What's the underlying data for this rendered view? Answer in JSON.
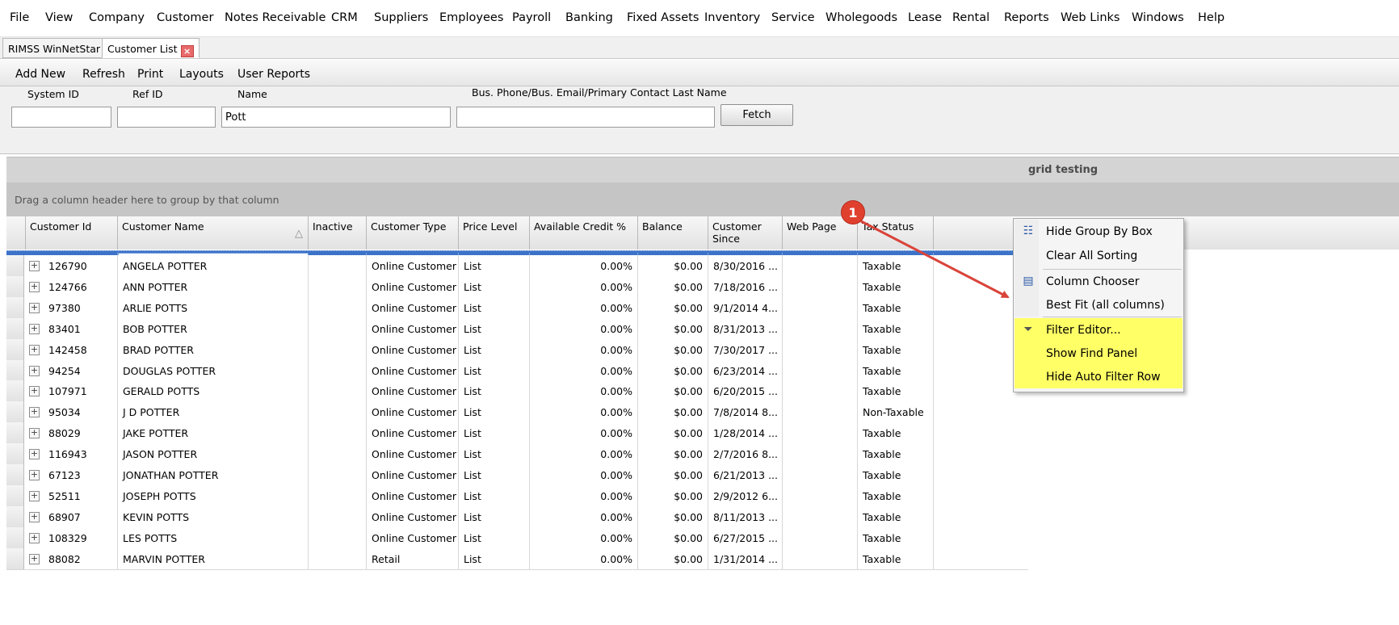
{
  "menu": [
    "File",
    "View",
    "Company",
    "Customer",
    "Notes Receivable",
    "CRM",
    "Suppliers",
    "Employees",
    "Payroll",
    "Banking",
    "Fixed Assets",
    "Inventory",
    "Service",
    "Wholegoods",
    "Lease",
    "Rental",
    "Reports",
    "Web Links",
    "Windows",
    "Help"
  ],
  "tabs": [
    {
      "label": "RIMSS WinNetStar"
    },
    {
      "label": "Customer List"
    }
  ],
  "toolbar": [
    "Add New",
    "Refresh",
    "Print",
    "Layouts",
    "User Reports"
  ],
  "filters": {
    "system_id_label": "System ID",
    "system_id_value": "",
    "ref_id_label": "Ref ID",
    "ref_id_value": "",
    "name_label": "Name",
    "name_value": "Pott",
    "contact_label": "Bus. Phone/Bus. Email/Primary Contact Last Name",
    "contact_value": "",
    "fetch_label": "Fetch"
  },
  "grid": {
    "caption": "grid testing",
    "group_prompt": "Drag a column header here to group by that column",
    "columns": [
      "Customer Id",
      "Customer Name",
      "Inactive",
      "Customer Type",
      "Price Level",
      "Available Credit %",
      "Balance",
      "Customer Since",
      "Web Page",
      "Tax Status"
    ],
    "rows": [
      [
        "126790",
        "ANGELA POTTER",
        "",
        "Online Customer",
        "List",
        "0.00%",
        "$0.00",
        "8/30/2016 ...",
        "",
        "Taxable"
      ],
      [
        "124766",
        "ANN POTTER",
        "",
        "Online Customer",
        "List",
        "0.00%",
        "$0.00",
        "7/18/2016 ...",
        "",
        "Taxable"
      ],
      [
        "97380",
        "ARLIE POTTS",
        "",
        "Online Customer",
        "List",
        "0.00%",
        "$0.00",
        "9/1/2014 4...",
        "",
        "Taxable"
      ],
      [
        "83401",
        "BOB POTTER",
        "",
        "Online Customer",
        "List",
        "0.00%",
        "$0.00",
        "8/31/2013 ...",
        "",
        "Taxable"
      ],
      [
        "142458",
        "BRAD POTTER",
        "",
        "Online Customer",
        "List",
        "0.00%",
        "$0.00",
        "7/30/2017 ...",
        "",
        "Taxable"
      ],
      [
        "94254",
        "DOUGLAS POTTER",
        "",
        "Online Customer",
        "List",
        "0.00%",
        "$0.00",
        "6/23/2014 ...",
        "",
        "Taxable"
      ],
      [
        "107971",
        "GERALD POTTS",
        "",
        "Online Customer",
        "List",
        "0.00%",
        "$0.00",
        "6/20/2015 ...",
        "",
        "Taxable"
      ],
      [
        "95034",
        "J D POTTER",
        "",
        "Online Customer",
        "List",
        "0.00%",
        "$0.00",
        "7/8/2014 8...",
        "",
        "Non-Taxable"
      ],
      [
        "88029",
        "JAKE POTTER",
        "",
        "Online Customer",
        "List",
        "0.00%",
        "$0.00",
        "1/28/2014 ...",
        "",
        "Taxable"
      ],
      [
        "116943",
        "JASON POTTER",
        "",
        "Online Customer",
        "List",
        "0.00%",
        "$0.00",
        "2/7/2016 8...",
        "",
        "Taxable"
      ],
      [
        "67123",
        "JONATHAN POTTER",
        "",
        "Online Customer",
        "List",
        "0.00%",
        "$0.00",
        "6/21/2013 ...",
        "",
        "Taxable"
      ],
      [
        "52511",
        "JOSEPH POTTS",
        "",
        "Online Customer",
        "List",
        "0.00%",
        "$0.00",
        "2/9/2012 6...",
        "",
        "Taxable"
      ],
      [
        "68907",
        "KEVIN POTTS",
        "",
        "Online Customer",
        "List",
        "0.00%",
        "$0.00",
        "8/11/2013 ...",
        "",
        "Taxable"
      ],
      [
        "108329",
        "LES POTTS",
        "",
        "Online Customer",
        "List",
        "0.00%",
        "$0.00",
        "6/27/2015 ...",
        "",
        "Taxable"
      ],
      [
        "88082",
        "MARVIN POTTER",
        "",
        "Retail",
        "List",
        "0.00%",
        "$0.00",
        "1/31/2014 ...",
        "",
        "Taxable"
      ]
    ]
  },
  "context_menu": {
    "items": [
      {
        "label": "Hide Group By Box",
        "icon": "group-box-icon",
        "highlight": false
      },
      {
        "label": "Clear All Sorting",
        "icon": "",
        "highlight": false
      },
      {
        "label": "Column Chooser",
        "icon": "column-chooser-icon",
        "highlight": false
      },
      {
        "label": "Best Fit (all columns)",
        "icon": "",
        "highlight": false
      },
      {
        "label": "Filter Editor...",
        "icon": "funnel-icon",
        "highlight": true
      },
      {
        "label": "Show Find Panel",
        "icon": "",
        "highlight": true
      },
      {
        "label": "Hide Auto Filter Row",
        "icon": "",
        "highlight": true
      }
    ]
  },
  "annotation": {
    "number": "1"
  },
  "colors": {
    "highlight": "#ffff66",
    "filter_row": "#3c73c9",
    "annotation": "#e0402e"
  }
}
